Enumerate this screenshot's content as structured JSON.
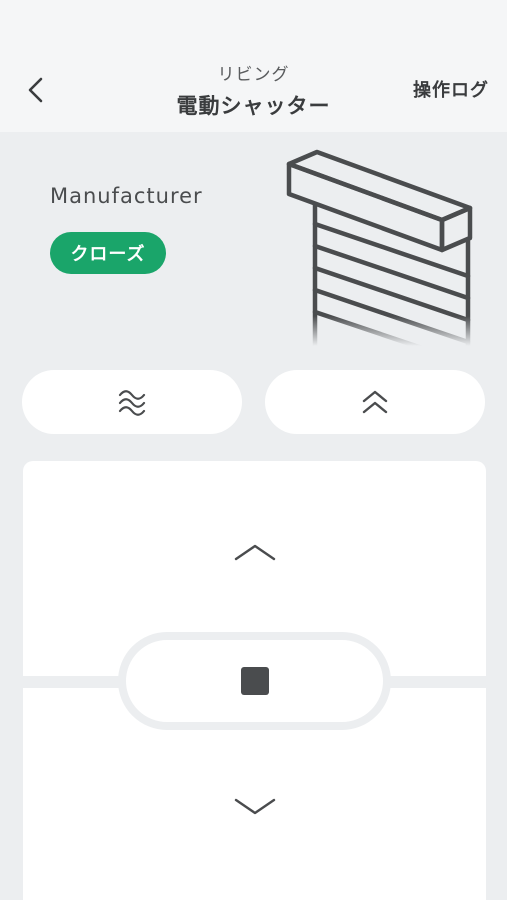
{
  "header": {
    "room": "リビング",
    "title": "電動シャッター",
    "log_label": "操作ログ"
  },
  "device": {
    "manufacturer": "Manufacturer",
    "status": "クローズ",
    "status_color": "#1aa56a"
  },
  "quick_buttons": {
    "left_icon": "vent-waves-icon",
    "right_icon": "double-chevron-up-icon"
  },
  "pad": {
    "up_icon": "chevron-up-icon",
    "stop_icon": "stop-icon",
    "down_icon": "chevron-down-icon"
  }
}
